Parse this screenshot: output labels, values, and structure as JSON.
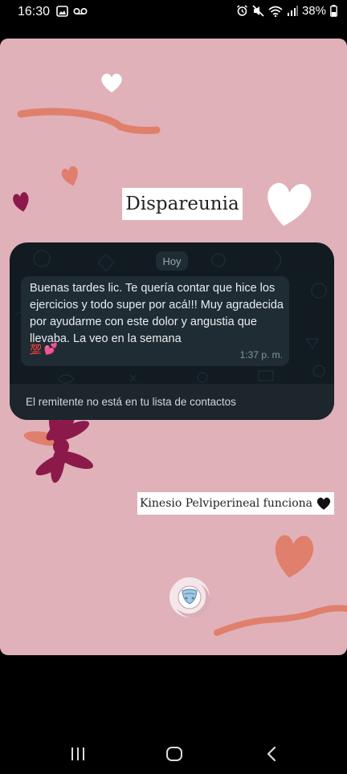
{
  "status_bar": {
    "time": "16:30",
    "battery": "38%",
    "left_icons": [
      "gallery-icon",
      "voicemail-icon"
    ],
    "right_icons": [
      "alarm-icon",
      "mute-icon",
      "wifi-icon",
      "signal-icon",
      "battery-icon"
    ]
  },
  "story": {
    "title": "Dispareunia",
    "caption": "Kinesio Pelviperineal funciona",
    "caption_emoji": "black-heart-icon",
    "colors": {
      "background": "#e0b1b8",
      "accent": "#e07f6c",
      "dark_accent": "#8b1a4a"
    }
  },
  "chat": {
    "day_label": "Hoy",
    "message": "Buenas tardes lic. Te quería contar que hice los ejercicios y todo super por acá!!! Muy agradecida por ayudarme con este dolor y angustia que llevaba. La veo en la semana",
    "emoji_hundred": "💯",
    "emoji_hearts": "💕",
    "time": "1:37 p. m.",
    "notice": "El remitente no está en tu lista de contactos"
  },
  "nav_bar": {
    "buttons": [
      "recent-apps-button",
      "home-button",
      "back-button"
    ]
  }
}
